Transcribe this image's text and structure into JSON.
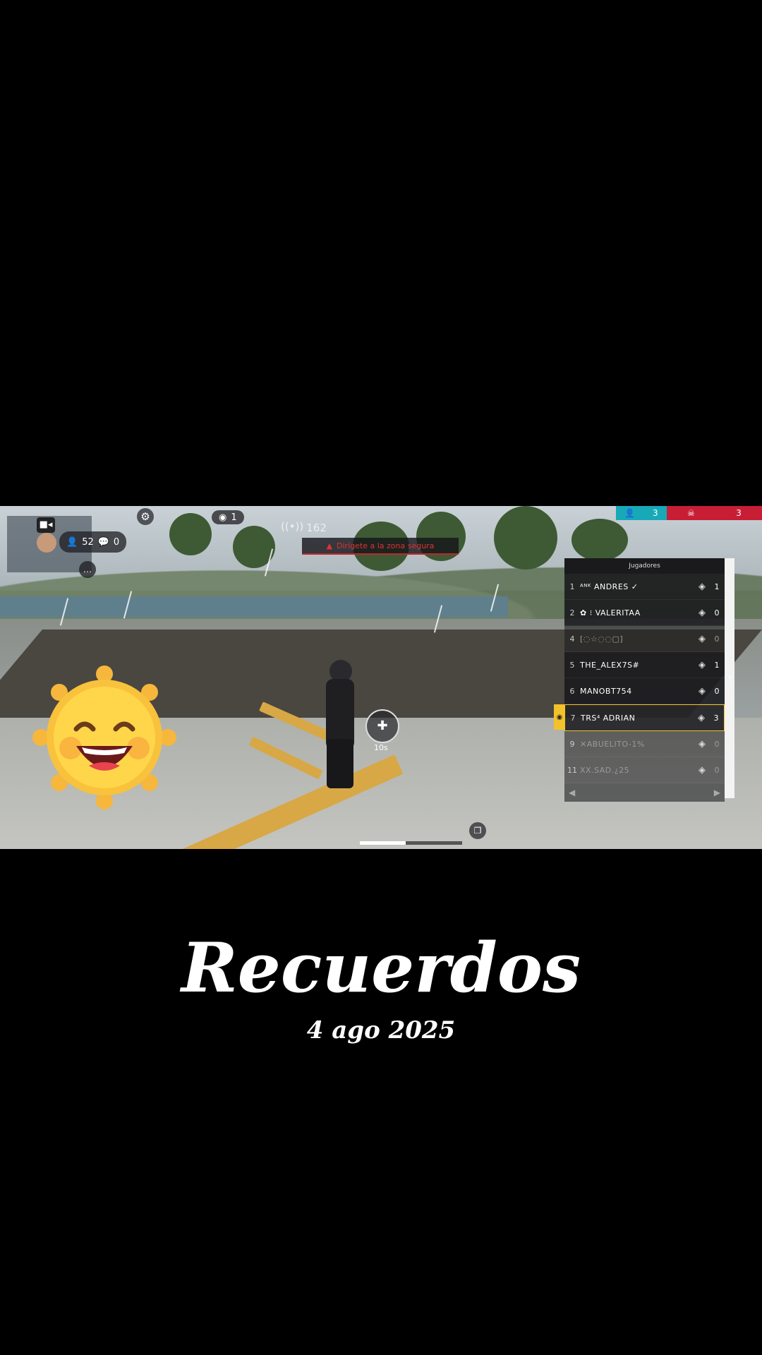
{
  "caption": {
    "title": "Recuerdos",
    "date": "4 ago 2025"
  },
  "hud": {
    "viewers_count": "52",
    "chat_count": "0",
    "spectators": "1",
    "ping": "162",
    "warning_text": "Dirígete a la zona segura",
    "medkit_timer": "10s",
    "team_blue_score": "3",
    "team_red_score": "3",
    "progress_fraction": 0.45
  },
  "scoreboard": {
    "header": "Jugadores",
    "players": [
      {
        "rank": "1",
        "name": "ᴬᴺᴷ ANDRES ✓",
        "kills": "1"
      },
      {
        "rank": "2",
        "name": "✿ ⁝ VALERITAA",
        "kills": "0"
      },
      {
        "rank": "4",
        "name": "[◌☆◌◌▢]",
        "kills": "0"
      },
      {
        "rank": "5",
        "name": "THE_ALEX7S#",
        "kills": "1"
      },
      {
        "rank": "6",
        "name": "MANOBT754",
        "kills": "0"
      },
      {
        "rank": "7",
        "name": "TRS⁴ ADRIAN",
        "kills": "3"
      },
      {
        "rank": "9",
        "name": "✕ABUELITO-1%",
        "kills": "0"
      },
      {
        "rank": "11",
        "name": "XX.SAD.¿25",
        "kills": "0"
      }
    ],
    "selected_index": 5
  },
  "colors": {
    "accent_yellow": "#f3c22b",
    "team_blue": "#17a9b8",
    "team_red": "#c81e35"
  },
  "icons": {
    "camera": "video-camera-icon",
    "settings": "gear-icon",
    "eye": "eye-icon",
    "wifi": "wifi-icon",
    "warning": "warning-triangle-icon",
    "skull": "skull-icon",
    "medkit": "medkit-icon",
    "sticker": "laughing-sun-emoji"
  }
}
